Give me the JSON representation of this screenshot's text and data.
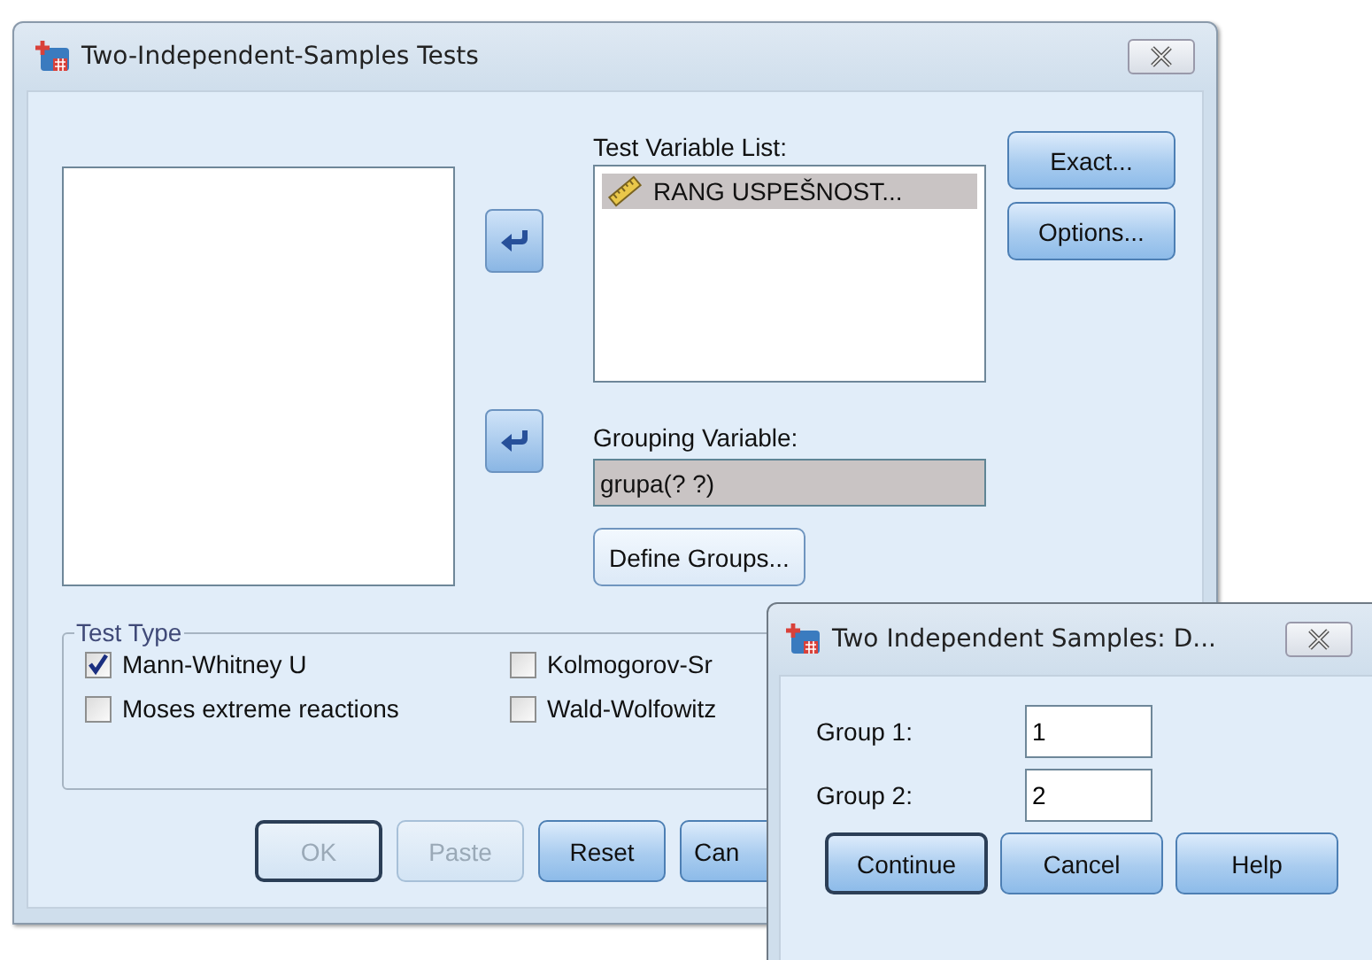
{
  "dialog": {
    "title": "Two-Independent-Samples Tests",
    "test_variable_list": {
      "label": "Test Variable List:",
      "items": [
        {
          "name": "RANG USPEŠNOST...",
          "selected": true
        }
      ]
    },
    "side_buttons": [
      "Exact...",
      "Options..."
    ],
    "grouping_variable": {
      "label": "Grouping Variable:",
      "value": "grupa(? ?)"
    },
    "define_groups_button": "Define Groups...",
    "test_type": {
      "title": "Test Type",
      "options": [
        {
          "label": "Mann-Whitney U",
          "checked": true
        },
        {
          "label": "Kolmogorov-Sr",
          "checked": false
        },
        {
          "label": "Moses extreme reactions",
          "checked": false
        },
        {
          "label": "Wald-Wolfowitz",
          "checked": false
        }
      ]
    },
    "buttons": [
      {
        "label": "OK",
        "disabled": true,
        "default": true
      },
      {
        "label": "Paste",
        "disabled": true,
        "default": false
      },
      {
        "label": "Reset",
        "disabled": false,
        "default": false
      },
      {
        "label": "Can",
        "disabled": false,
        "default": false
      }
    ]
  },
  "define_groups_dialog": {
    "title": "Two Independent Samples: D...",
    "fields": [
      {
        "label": "Group 1:",
        "value": "1"
      },
      {
        "label": "Group 2:",
        "value": "2"
      }
    ],
    "buttons": [
      {
        "label": "Continue",
        "default": true
      },
      {
        "label": "Cancel",
        "default": false
      },
      {
        "label": "Help",
        "default": false
      }
    ]
  }
}
